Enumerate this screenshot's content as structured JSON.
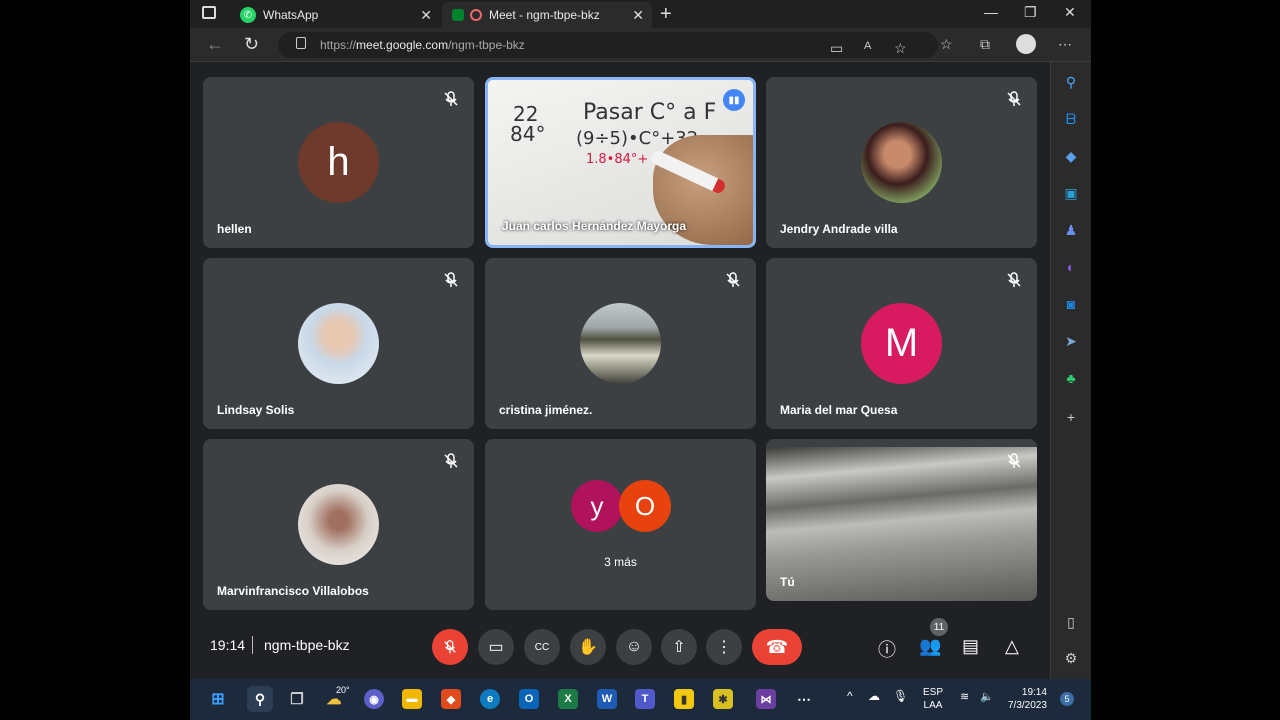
{
  "browser": {
    "tabs": [
      {
        "title": "WhatsApp"
      },
      {
        "title": "Meet - ngm-tbpe-bkz"
      }
    ],
    "url_prefix": "https://",
    "url_host": "meet.google.com",
    "url_path": "/ngm-tbpe-bkz"
  },
  "participants": [
    {
      "name": "hellen",
      "initial": "h",
      "color": "#6d3a2b",
      "muted": true
    },
    {
      "name": "Juan carlos Hernández Mayorga",
      "speaking": true,
      "video": true
    },
    {
      "name": "Jendry Andrade villa",
      "photo": true,
      "muted": true
    },
    {
      "name": "Lindsay Solis",
      "photo": true,
      "muted": true
    },
    {
      "name": "cristina jiménez.",
      "photo": true,
      "muted": true
    },
    {
      "name": "Maria del mar Quesa",
      "initial": "M",
      "color": "#d81b60",
      "muted": true
    },
    {
      "name": "Marvinfrancisco Villalobos",
      "photo": true,
      "muted": true
    },
    {
      "name": "3 más",
      "more_avatars": [
        "y",
        "O"
      ],
      "more_colors": [
        "#b0125b",
        "#e8430f"
      ]
    },
    {
      "name": "Tú",
      "video": true,
      "muted": true
    }
  ],
  "whiteboard": {
    "line1_left": "22",
    "line2_left": "84°",
    "title": "Pasar C° a F",
    "formula": "(9÷5)•C°+32",
    "calc": "1.8•84°+"
  },
  "controls": {
    "time": "19:14",
    "meeting_code": "ngm-tbpe-bkz",
    "people_count": "11"
  },
  "taskbar": {
    "weather": "20°",
    "lang_top": "ESP",
    "lang_bottom": "LAA",
    "clock_time": "19:14",
    "clock_date": "7/3/2023",
    "notif": "5"
  },
  "colors": {
    "meet_bg": "#202124",
    "tile_bg": "#3c4043",
    "end_call": "#ea4335",
    "speaking_border": "#8ab4f8"
  }
}
